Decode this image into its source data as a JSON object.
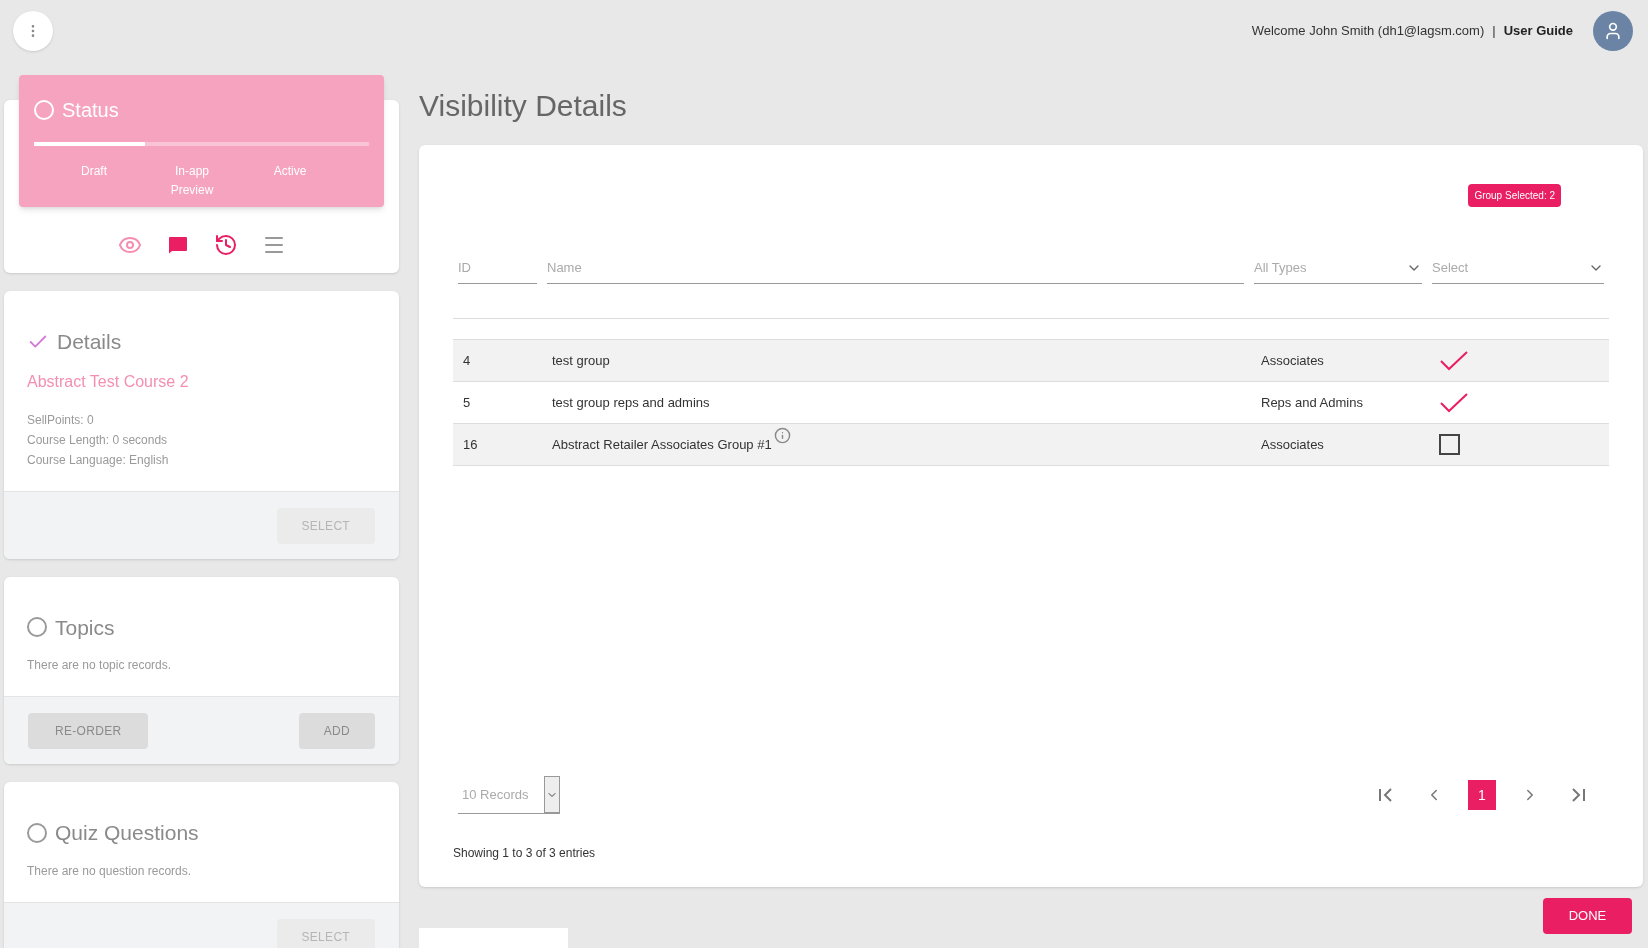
{
  "header": {
    "welcome": "Welcome John Smith (dh1@lagsm.com)",
    "separator": "|",
    "guide_link": "User Guide"
  },
  "status": {
    "title": "Status",
    "level": 0.33,
    "steps": [
      "Draft",
      "In-app Preview",
      "Active"
    ]
  },
  "sections": [
    {
      "title": "Details",
      "completed": true,
      "subtitle": "Abstract Test Course 2",
      "lines": [
        "SellPoints: 0",
        "Course Length: 0 seconds",
        "Course Language: English"
      ],
      "right_buttons": [
        {
          "label": "SELECT",
          "disabled": true
        }
      ]
    },
    {
      "title": "Topics",
      "completed": false,
      "lines": [
        "There are no topic records."
      ],
      "left_buttons": [
        {
          "label": "RE-ORDER",
          "disabled": false
        }
      ],
      "right_buttons": [
        {
          "label": "ADD",
          "disabled": false
        }
      ]
    },
    {
      "title": "Quiz Questions",
      "completed": false,
      "lines": [
        "There are no question records."
      ],
      "right_buttons": [
        {
          "label": "SELECT",
          "disabled": true
        }
      ]
    }
  ],
  "page_title": "Visibility Details",
  "badge": "Group Selected: 2",
  "filters": {
    "id": {
      "placeholder": "ID"
    },
    "name": {
      "placeholder": "Name"
    },
    "type": {
      "value": "All Types"
    },
    "select": {
      "value": "Select"
    }
  },
  "rows": [
    {
      "id": "4",
      "name": "test group",
      "type": "Associates",
      "info": false,
      "checked": true
    },
    {
      "id": "5",
      "name": "test group reps and admins",
      "type": "Reps and Admins",
      "info": false,
      "checked": true
    },
    {
      "id": "16",
      "name": "Abstract Retailer Associates Group #1",
      "type": "Associates",
      "info": true,
      "checked": false
    }
  ],
  "records": "10 Records",
  "pages": [
    {
      "label": "1",
      "selected": true
    }
  ],
  "showing": "Showing 1 to 3 of 3 entries",
  "done": "DONE"
}
